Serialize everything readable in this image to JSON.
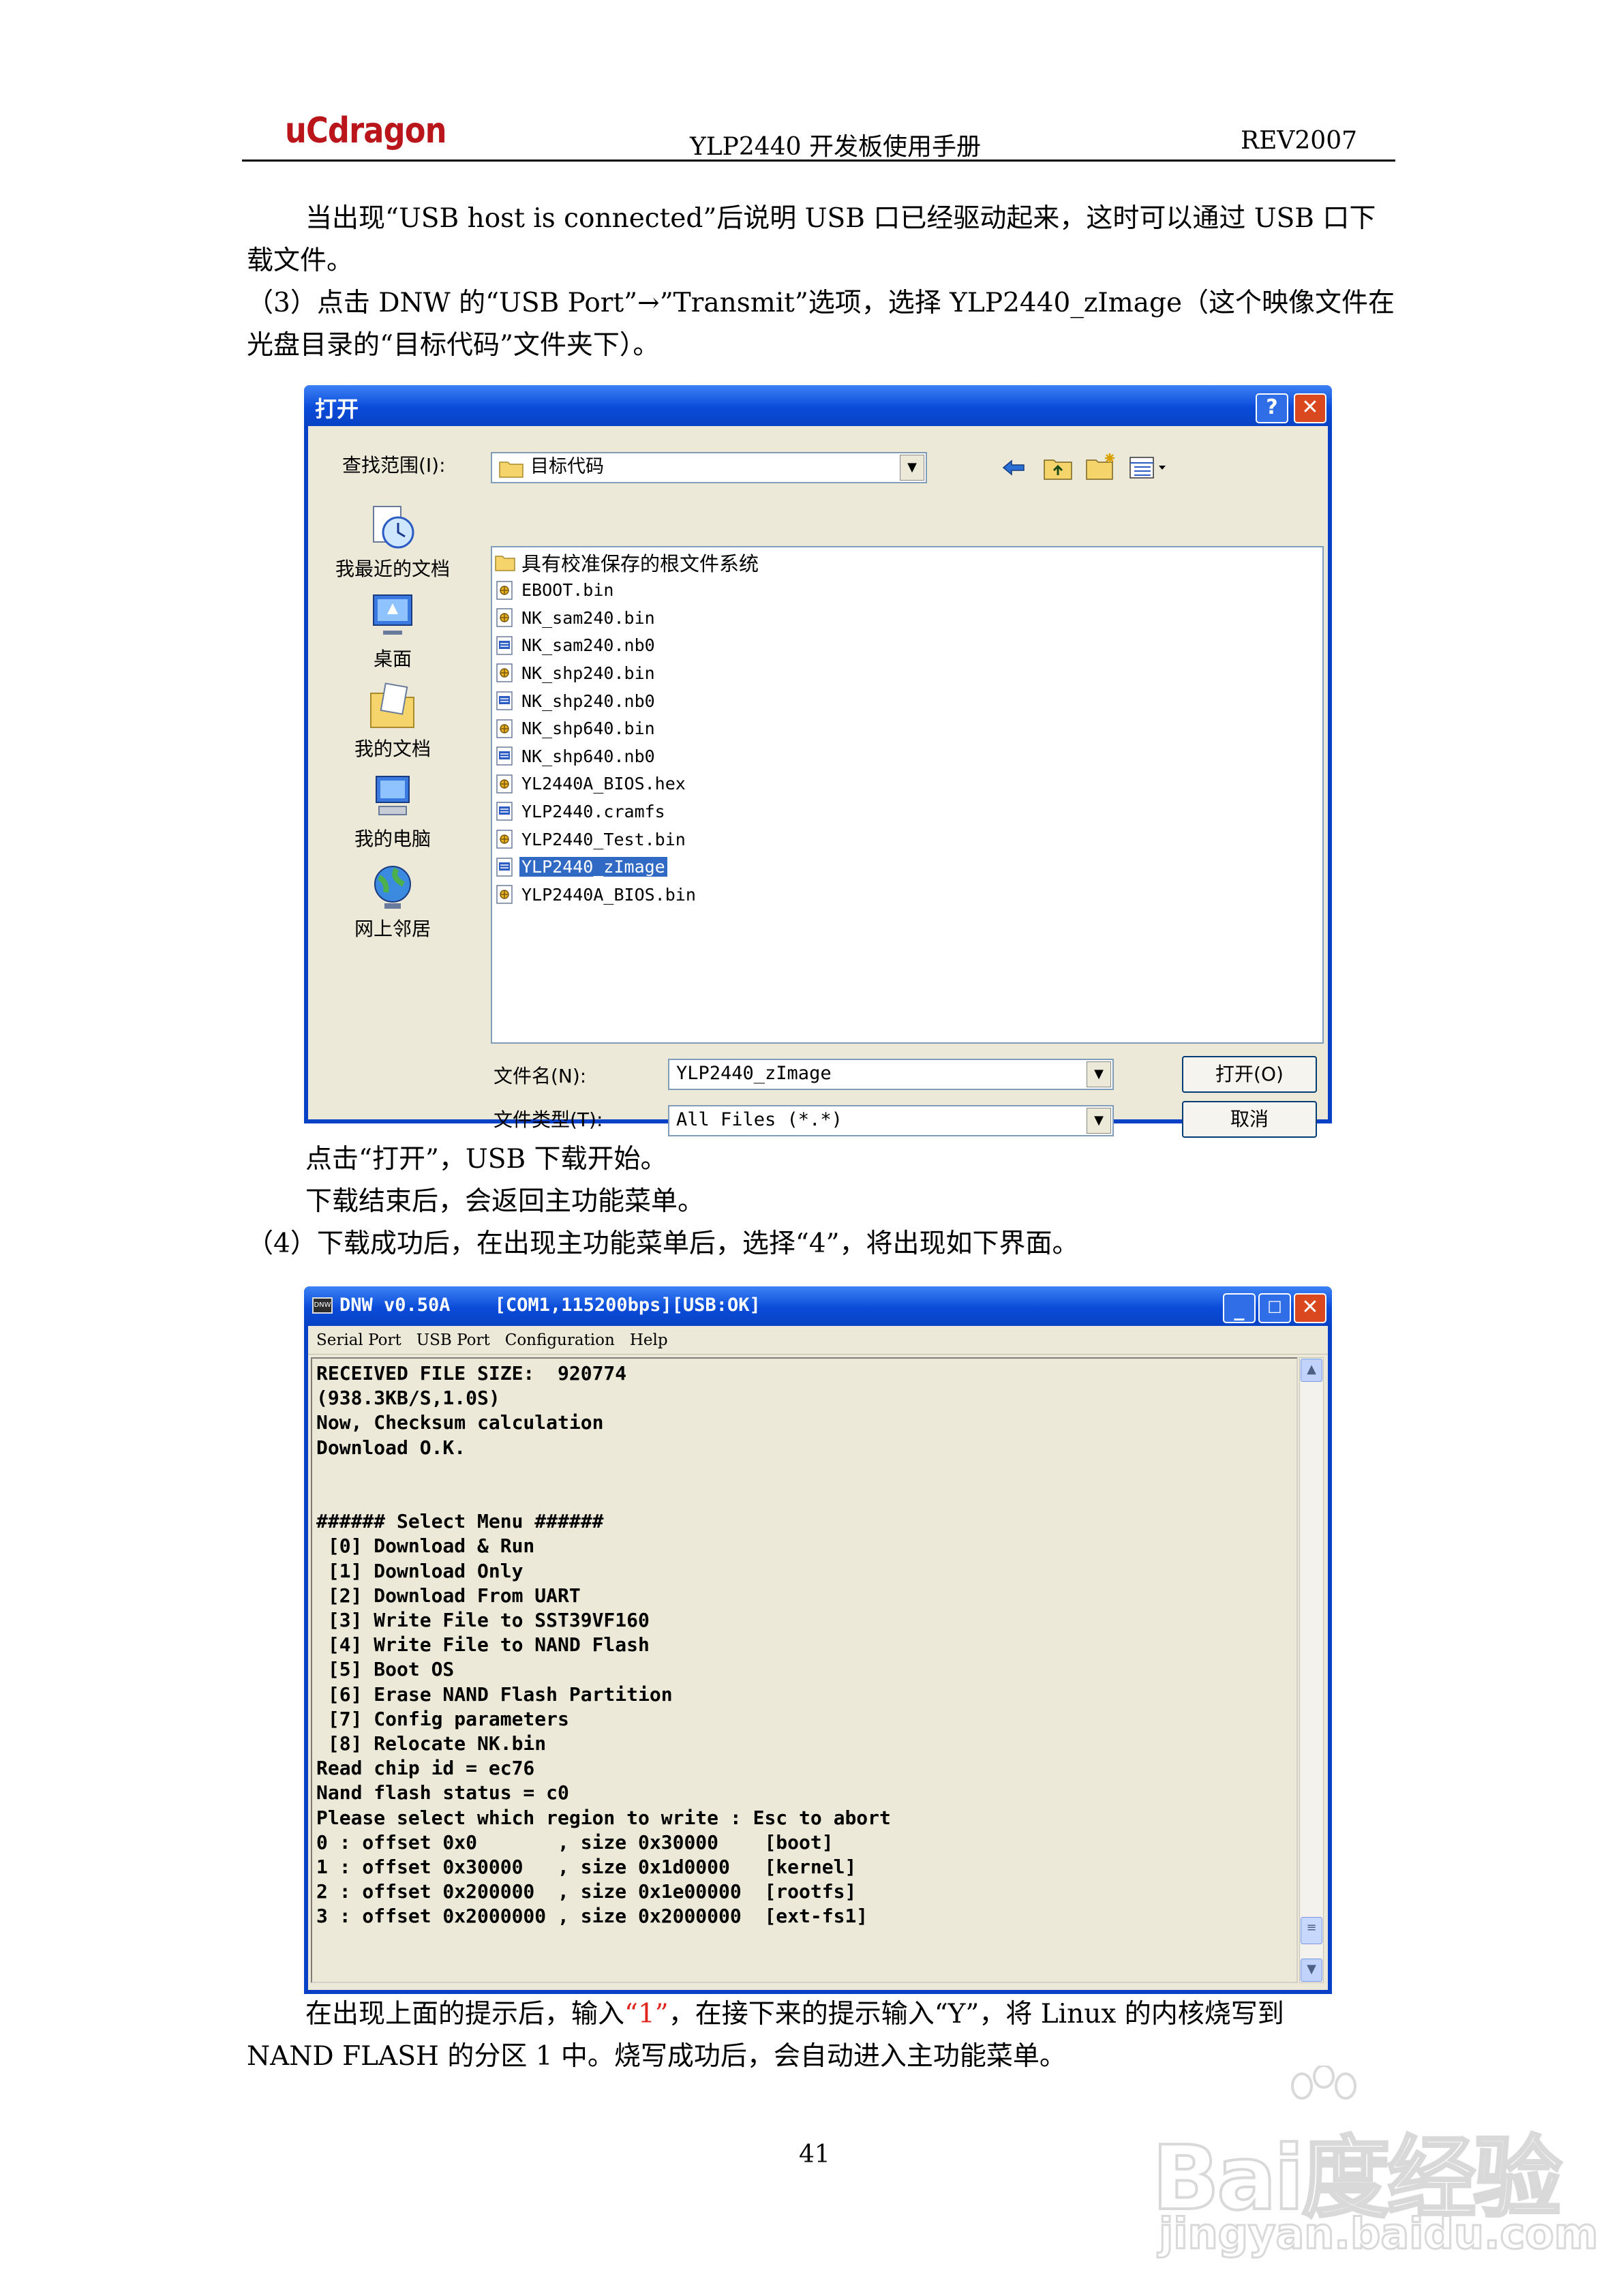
{
  "header": {
    "logo": "uCdragon",
    "title": "YLP2440  开发板使用手册",
    "revision": "REV2007"
  },
  "paragraphs": {
    "p1_line1": "当出现“USB host is connected”后说明 USB 口已经驱动起来，这时可以通过 USB 口下",
    "p1_line2": "载文件。",
    "p2_line1": "（3）点击 DNW 的“USB Port”→”Transmit”选项，选择 YLP2440_zImage（这个映像文件在",
    "p2_line2": "光盘目录的“目标代码”文件夹下）。",
    "p3": "点击“打开”，USB 下载开始。",
    "p4": "下载结束后，会返回主功能菜单。",
    "p5": "（4）下载成功后，在出现主功能菜单后，选择“4”，将出现如下界面。",
    "p6_before": "在出现上面的提示后，输入",
    "p6_highlight": "“1”",
    "p6_after": "，在接下来的提示输入“Y”，将 Linux 的内核烧写到",
    "p6_line2": "NAND FLASH 的分区 1 中。烧写成功后，会自动进入主功能菜单。",
    "highlight_color": "#e0241c"
  },
  "open_dialog": {
    "title": "打开",
    "help_btn": "?",
    "close_btn": "✕",
    "look_in_label": "查找范围(I):",
    "look_in_value": "目标代码",
    "places": [
      "我最近的文档",
      "桌面",
      "我的文档",
      "我的电脑",
      "网上邻居"
    ],
    "files": [
      {
        "name": "具有校准保存的根文件系统",
        "icon": "folder-icon"
      },
      {
        "name": "EBOOT.bin",
        "icon": "bin-file-icon"
      },
      {
        "name": "NK_sam240.bin",
        "icon": "bin-file-icon"
      },
      {
        "name": "NK_sam240.nb0",
        "icon": "nb0-file-icon"
      },
      {
        "name": "NK_shp240.bin",
        "icon": "bin-file-icon"
      },
      {
        "name": "NK_shp240.nb0",
        "icon": "nb0-file-icon"
      },
      {
        "name": "NK_shp640.bin",
        "icon": "bin-file-icon"
      },
      {
        "name": "NK_shp640.nb0",
        "icon": "nb0-file-icon"
      },
      {
        "name": "YL2440A_BIOS.hex",
        "icon": "bin-file-icon"
      },
      {
        "name": "YLP2440.cramfs",
        "icon": "nb0-file-icon"
      },
      {
        "name": "YLP2440_Test.bin",
        "icon": "bin-file-icon"
      },
      {
        "name": "YLP2440_zImage",
        "icon": "nb0-file-icon"
      },
      {
        "name": "YLP2440A_BIOS.bin",
        "icon": "bin-file-icon"
      }
    ],
    "selected_index": 11,
    "filename_label": "文件名(N):",
    "filename_value": "YLP2440_zImage",
    "filetype_label": "文件类型(T):",
    "filetype_value": "All Files (*.*)",
    "open_btn": "打开(O)",
    "cancel_btn": "取消"
  },
  "dnw_window": {
    "title": "DNW v0.50A    [COM1,115200bps][USB:OK]",
    "app_icon": "DNW",
    "menu": [
      "Serial Port",
      "USB Port",
      "Configuration",
      "Help"
    ],
    "terminal_lines": [
      "RECEIVED FILE SIZE:  920774",
      "(938.3KB/S,1.0S)",
      "Now, Checksum calculation",
      "Download O.K.",
      "",
      "",
      "###### Select Menu ######",
      " [0] Download & Run",
      " [1] Download Only",
      " [2] Download From UART",
      " [3] Write File to SST39VF160",
      " [4] Write File to NAND Flash",
      " [5] Boot OS",
      " [6] Erase NAND Flash Partition",
      " [7] Config parameters",
      " [8] Relocate NK.bin",
      "Read chip id = ec76",
      "Nand flash status = c0",
      "Please select which region to write : Esc to abort",
      "0 : offset 0x0       , size 0x30000    [boot]",
      "1 : offset 0x30000   , size 0x1d0000   [kernel]",
      "2 : offset 0x200000  , size 0x1e00000  [rootfs]",
      "3 : offset 0x2000000 , size 0x2000000  [ext-fs1]"
    ]
  },
  "footer": {
    "page_number": "41",
    "watermark_main": "Bai度经验",
    "watermark_sub": "jingyan.baidu.com"
  }
}
